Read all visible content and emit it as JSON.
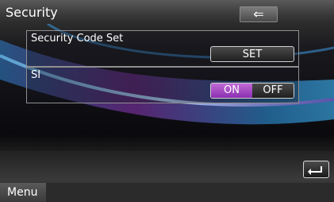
{
  "header": {
    "title": "Security",
    "back_icon": "back-arrow-icon"
  },
  "security_code": {
    "label": "Security Code Set",
    "button_label": "SET"
  },
  "si": {
    "label": "SI",
    "on_label": "ON",
    "off_label": "OFF",
    "selected": "ON"
  },
  "footer": {
    "menu_label": "Menu",
    "return_icon": "return-icon"
  },
  "colors": {
    "accent_on": "#a446c6",
    "panel_border": "#8f8f8f"
  }
}
